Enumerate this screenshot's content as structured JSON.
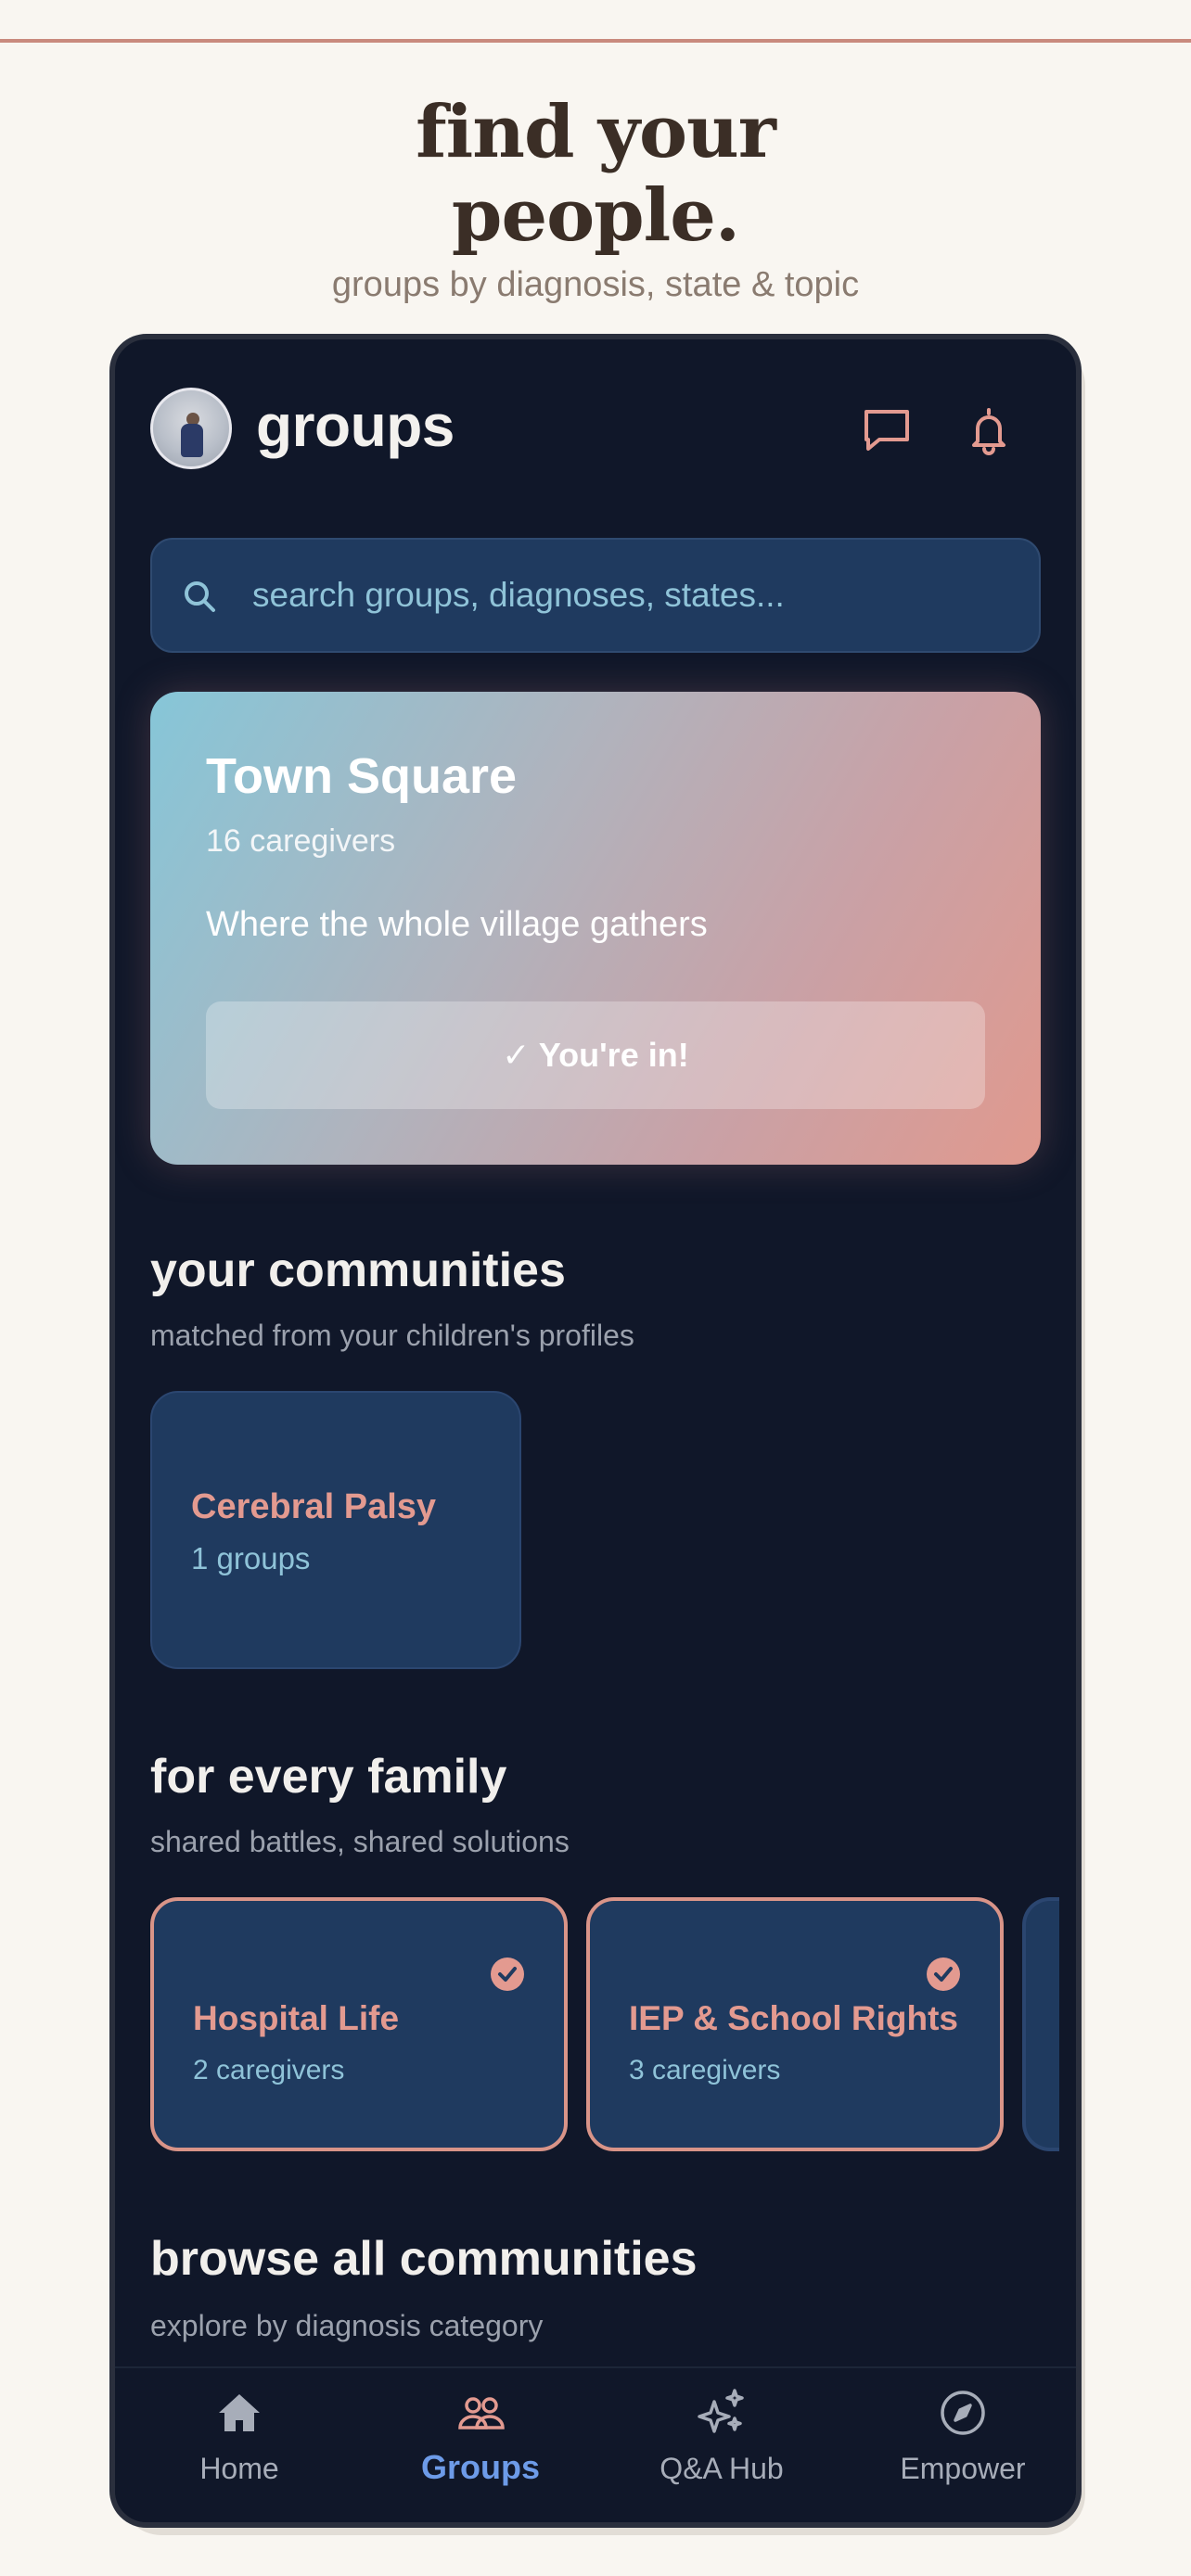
{
  "promo": {
    "headline_line1": "find your",
    "headline_line2": "people.",
    "subhead": "groups by diagnosis, state & topic"
  },
  "header": {
    "title": "groups",
    "icons": [
      "avatar",
      "message-icon",
      "bell-icon"
    ]
  },
  "search": {
    "placeholder": "search groups, diagnoses, states..."
  },
  "town_square": {
    "title": "Town Square",
    "count": "16 caregivers",
    "description": "Where the whole village gathers",
    "button_label": "✓ You're in!"
  },
  "your_communities": {
    "title": "your communities",
    "subtitle": "matched from your children's profiles",
    "items": [
      {
        "name": "Cerebral Palsy",
        "count": "1 groups"
      }
    ]
  },
  "every_family": {
    "title": "for every family",
    "subtitle": "shared battles, shared solutions",
    "items": [
      {
        "name": "Hospital Life",
        "count": "2 caregivers",
        "joined": true
      },
      {
        "name": "IEP & School Rights",
        "count": "3 caregivers",
        "joined": true
      }
    ]
  },
  "browse": {
    "title": "browse all communities",
    "subtitle": "explore by diagnosis category"
  },
  "nav": {
    "items": [
      {
        "label": "Home",
        "icon": "home-icon",
        "active": false
      },
      {
        "label": "Groups",
        "icon": "groups-icon",
        "active": true
      },
      {
        "label": "Q&A Hub",
        "icon": "sparkles-icon",
        "active": false
      },
      {
        "label": "Empower",
        "icon": "compass-icon",
        "active": false
      }
    ]
  },
  "colors": {
    "background": "#f9f6f1",
    "phone_bg": "#101729",
    "card_bg": "#1f3a5f",
    "accent_coral": "#e39a90",
    "accent_blue": "#8fc3d8",
    "nav_active": "#6d9be8"
  }
}
